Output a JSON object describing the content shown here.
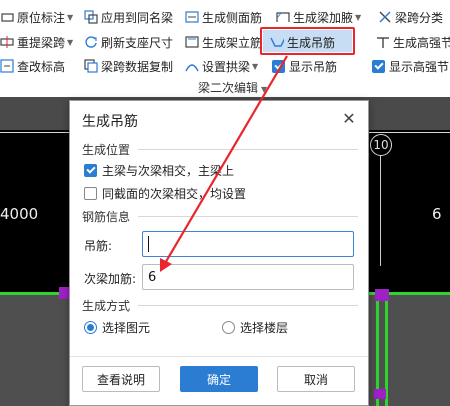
{
  "ribbon": {
    "row1": {
      "origin_mark": "原位标注",
      "apply_same_name": "应用到同名梁",
      "gen_side_rebar": "生成侧面筋",
      "gen_haunch_rebar": "生成梁加腋",
      "span_classify": "梁跨分类"
    },
    "row2": {
      "re_extract_span": "重提梁跨",
      "refresh_support": "刷新支座尺寸",
      "gen_erect_rebar": "生成架立筋",
      "gen_hanger_rebar": "生成吊筋",
      "gen_high_strength": "生成高强节"
    },
    "row3": {
      "check_elevation": "查改标高",
      "copy_span_data": "梁跨数据复制",
      "set_arch_beam": "设置拱梁",
      "show_hanger": "显示吊筋",
      "show_high_strength": "显示高强节"
    },
    "group_label": "梁二次编辑"
  },
  "canvas": {
    "axis_number": "10",
    "dim_left": "4000",
    "dim_right": "6"
  },
  "dialog": {
    "title": "生成吊筋",
    "section_position": "生成位置",
    "opt_main_secondary": "主梁与次梁相交，主梁上",
    "opt_same_section": "同截面的次梁相交，均设置",
    "section_rebar": "钢筋信息",
    "hanger_label": "吊筋:",
    "hanger_value": "",
    "stirrup_label": "次梁加筋:",
    "stirrup_value": "6",
    "section_method": "生成方式",
    "radio_select_element": "选择图元",
    "radio_select_floor": "选择楼层",
    "btn_help": "查看说明",
    "btn_ok": "确定",
    "btn_cancel": "取消"
  },
  "colors": {
    "accent": "#2b7cd3",
    "highlight_border": "#e8262b",
    "rebar_green": "#2fd42f",
    "support_purple": "#a020c8"
  }
}
